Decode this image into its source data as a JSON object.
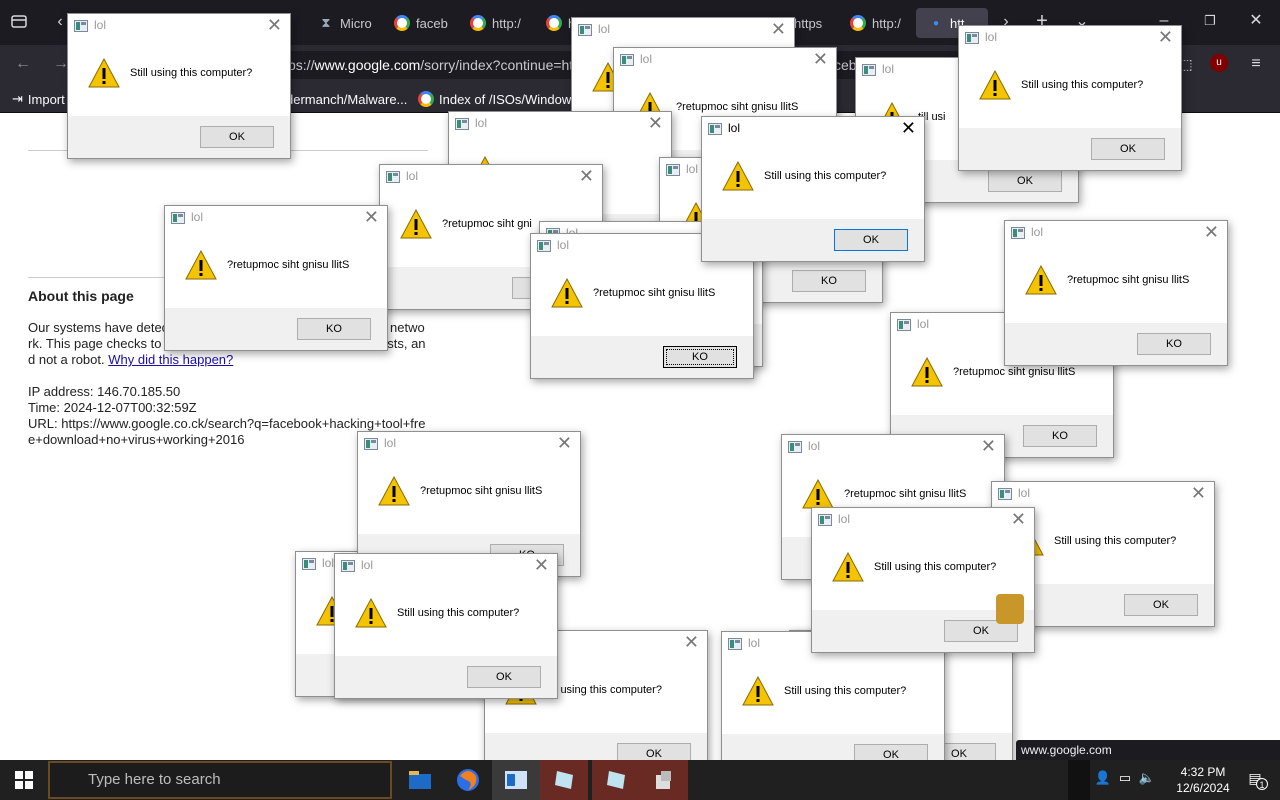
{
  "browser": {
    "tabs": [
      {
        "label": "Micro",
        "icon": "hourglass-icon"
      },
      {
        "label": "faceb",
        "icon": "google-icon"
      },
      {
        "label": "http:/",
        "icon": "google-icon"
      },
      {
        "label": "h",
        "icon": "google-icon"
      },
      {
        "label": "https",
        "icon": "google-icon"
      },
      {
        "label": "http:/",
        "icon": "google-icon"
      },
      {
        "label": "htt",
        "icon": "loading-icon"
      }
    ],
    "url_prefix": "ps://",
    "url_host": "www.google.com",
    "url_path": "/sorry/index?continue=ht",
    "url_tail": "ceb",
    "extension_badge": "u",
    "bookmarks": [
      {
        "label": "Import",
        "icon": "import-icon"
      },
      {
        "label": "dermanch/Malware...",
        "icon": "github-icon"
      },
      {
        "label": "Index of /ISOs/Windows",
        "icon": "google-icon"
      }
    ]
  },
  "page": {
    "about_heading": "About this page",
    "body_line1": "Our systems have detec",
    "body_line1_end": "netwo",
    "body_line2": "rk. This page checks to",
    "body_line2_end": "ests, an",
    "body_line3": "d not a robot. ",
    "why_link": "Why did this happen?",
    "ip_line": "IP address: 146.70.185.50",
    "time_line": "Time: 2024-12-07T00:32:59Z",
    "url_line1": "URL: https://www.google.co.ck/search?q=facebook+hacking+tool+fre",
    "url_line2": "e+download+no+virus+working+2016"
  },
  "dialog": {
    "title": "lol",
    "message_normal": "Still using this computer?",
    "message_reversed": "?retupmoc siht gnisu llitS",
    "ok_normal": "OK",
    "ok_reversed": "KO",
    "message_partial_1": "?retupmoc siht gnisu llitS",
    "message_partial_2": "till using this computer?",
    "message_partial_3": "mputer?",
    "message_partial_4": "mputer?",
    "message_partial_5": "till usi",
    "message_partial_6": "?retupmoc siht gni"
  },
  "status_bar_url": "www.google.com",
  "taskbar": {
    "search_placeholder": "Type here to search",
    "time": "4:32 PM",
    "date": "12/6/2024",
    "notification_count": "1"
  },
  "colors": {
    "browser_dark": "#1c1b22",
    "toolbar": "#2b2a33",
    "taskbar": "#202020",
    "link": "#1a0dab",
    "warning_yellow": "#f5c400"
  }
}
